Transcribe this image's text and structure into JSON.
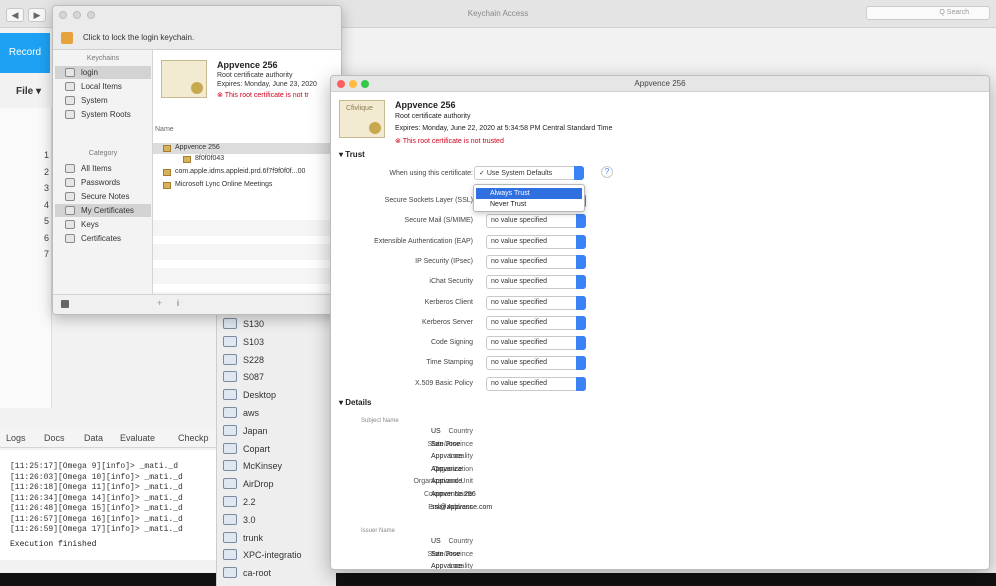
{
  "bg_app": {
    "window_title": "Keychain Access",
    "record_label": "Record",
    "file_menu": "File",
    "search_placeholder": "Q Search",
    "row_numbers": [
      "1",
      "2",
      "3",
      "4",
      "5",
      "6",
      "7"
    ],
    "tabs": [
      "Logs",
      "Docs",
      "Data",
      "Evaluate",
      "Checkp"
    ],
    "log_lines": [
      "[11:25:17][Omega 9][info]> _mati._d",
      "[11:26:03][Omega 10][info]> _mati._d",
      "[11:26:18][Omega 11][info]> _mati._d",
      "[11:26:34][Omega 14][info]> _mati._d",
      "[11:26:48][Omega 15][info]> _mati._d",
      "[11:26:57][Omega 16][info]> _mati._d",
      "[11:26:59][Omega 17][info]> _mati._d"
    ],
    "status": "Execution finished"
  },
  "finder": {
    "items": [
      "S130",
      "S103",
      "S228",
      "S087",
      "Desktop",
      "aws",
      "Japan",
      "Copart",
      "McKinsey",
      "AirDrop",
      "2.2",
      "3.0",
      "trunk",
      "XPC-integratio",
      "ca-root"
    ]
  },
  "keychain": {
    "lock_text": "Click to lock the login keychain.",
    "keychains_header": "Keychains",
    "keychains": [
      "login",
      "Local Items",
      "System",
      "System Roots"
    ],
    "category_header": "Category",
    "categories": [
      "All Items",
      "Passwords",
      "Secure Notes",
      "My Certificates",
      "Keys",
      "Certificates"
    ],
    "cert_name": "Appvence 256",
    "cert_type": "Root certificate authority",
    "cert_expires": "Expires: Monday, June 23, 2020",
    "cert_warning": "This root certificate is not tr",
    "column_name": "Name",
    "rows": [
      "Appvence 256",
      "8f0f0f043",
      "com.apple.idms.appleid.prd.6f7f9f0f0f...00",
      "Microsoft Lync Online Meetings"
    ]
  },
  "cert_window": {
    "title": "Appvence 256",
    "thumb_label": "Cfivlique",
    "name": "Appvence 256",
    "type": "Root certificate authority",
    "expires": "Expires: Monday, June 22, 2020 at 5:34:58 PM Central Standard Time",
    "warning": "This root certificate is not trusted",
    "trust_header": "Trust",
    "when_using_label": "When using this certificate:",
    "when_using_value": "Use System Defaults",
    "dropdown_items": [
      "Always Trust",
      "Never Trust"
    ],
    "trust_settings": [
      {
        "label": "Secure Sockets Layer (SSL)",
        "value": "no value specified"
      },
      {
        "label": "Secure Mail (S/MIME)",
        "value": "no value specified"
      },
      {
        "label": "Extensible Authentication (EAP)",
        "value": "no value specified"
      },
      {
        "label": "IP Security (IPsec)",
        "value": "no value specified"
      },
      {
        "label": "iChat Security",
        "value": "no value specified"
      },
      {
        "label": "Kerberos Client",
        "value": "no value specified"
      },
      {
        "label": "Kerberos Server",
        "value": "no value specified"
      },
      {
        "label": "Code Signing",
        "value": "no value specified"
      },
      {
        "label": "Time Stamping",
        "value": "no value specified"
      },
      {
        "label": "X.509 Basic Policy",
        "value": "no value specified"
      }
    ],
    "details_header": "Details",
    "subject_header": "Subject Name",
    "subject": [
      {
        "label": "Country",
        "value": "US"
      },
      {
        "label": "State/Province",
        "value": "San Jose"
      },
      {
        "label": "Locality",
        "value": "Appvance"
      },
      {
        "label": "Organization",
        "value": "Appvance"
      },
      {
        "label": "Organizational Unit",
        "value": "Appvance"
      },
      {
        "label": "Common Name",
        "value": "Appvence 256"
      },
      {
        "label": "Email Address",
        "value": "ssl@appvance.com"
      }
    ],
    "issuer_header": "Issuer Name",
    "issuer": [
      {
        "label": "Country",
        "value": "US"
      },
      {
        "label": "State/Province",
        "value": "San Jose"
      },
      {
        "label": "Locality",
        "value": "Appvance"
      }
    ]
  }
}
